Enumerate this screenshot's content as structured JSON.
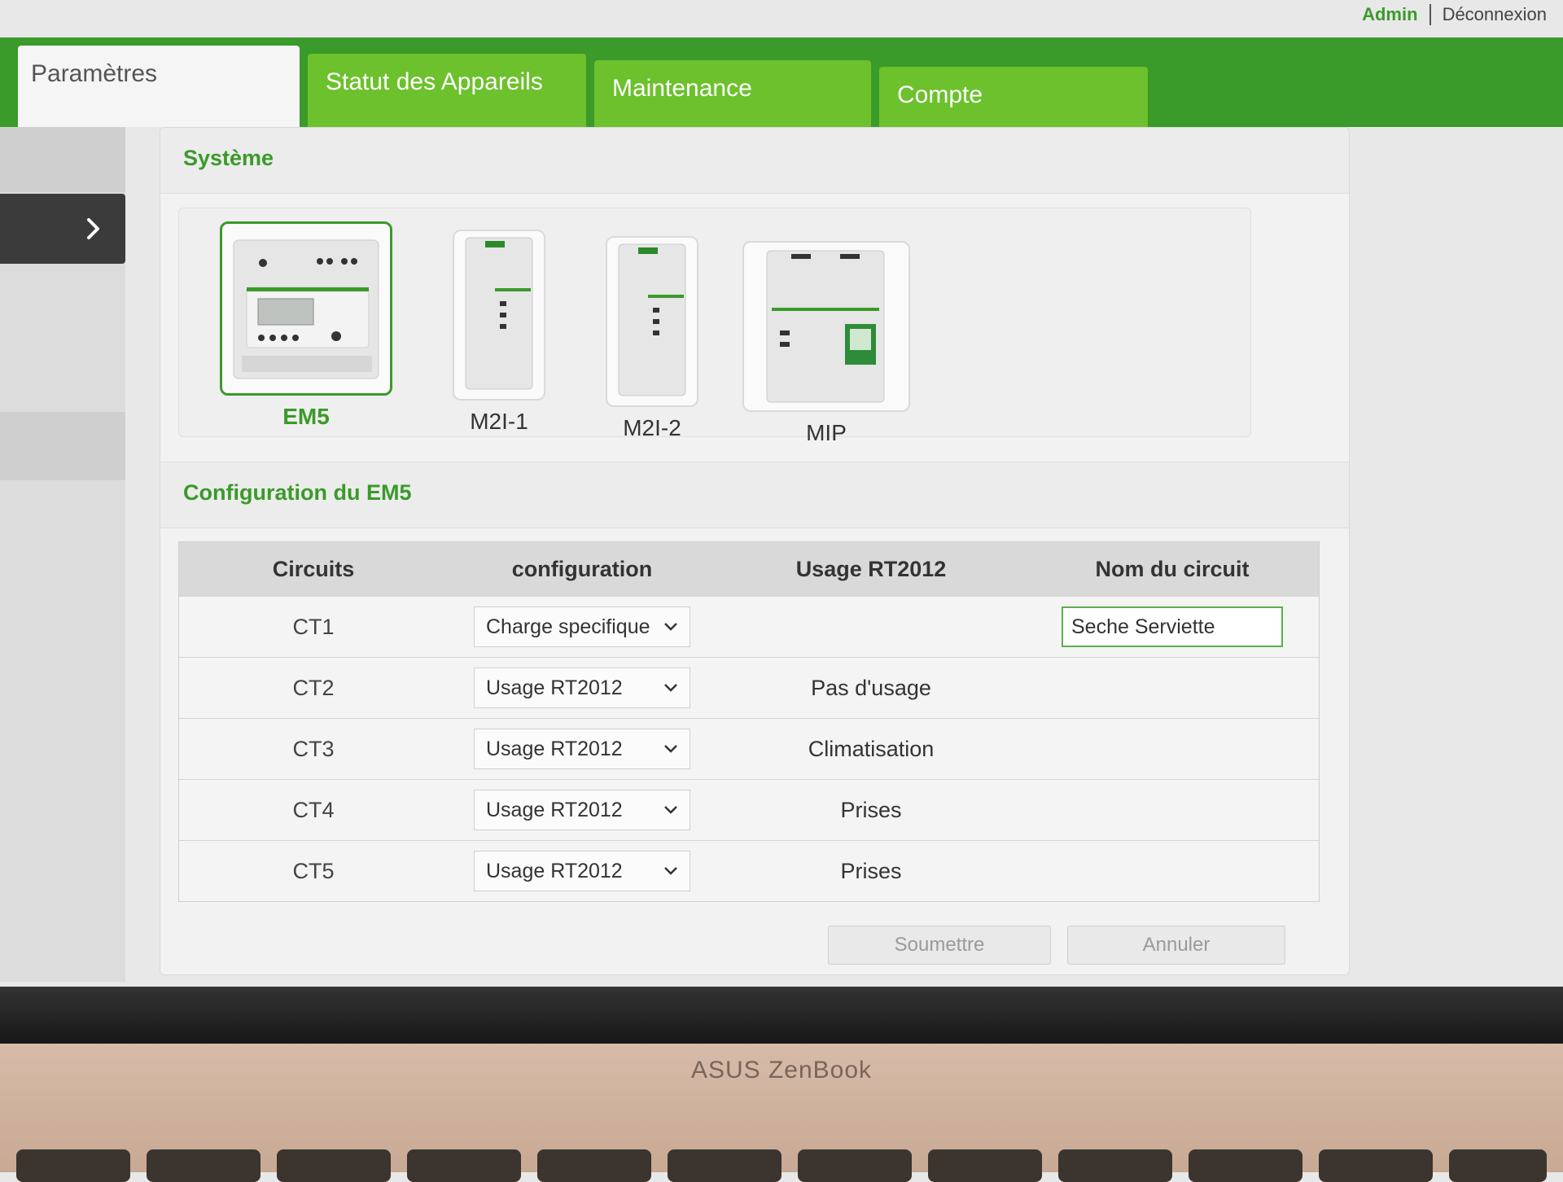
{
  "user": {
    "name": "Admin",
    "logout_label": "Déconnexion"
  },
  "nav": {
    "tabs": [
      {
        "label": "Paramètres",
        "active": true
      },
      {
        "label": "Statut des Appareils",
        "active": false
      },
      {
        "label": "Maintenance",
        "active": false
      },
      {
        "label": "Compte",
        "active": false
      }
    ]
  },
  "sidebar": {
    "toggle_icon": "chevron-right-icon"
  },
  "system": {
    "title": "Système",
    "devices": [
      {
        "label": "EM5",
        "selected": true
      },
      {
        "label": "M2I-1",
        "selected": false
      },
      {
        "label": "M2I-2",
        "selected": false
      },
      {
        "label": "MIP",
        "selected": false
      }
    ]
  },
  "config": {
    "title": "Configuration du EM5",
    "headers": [
      "Circuits",
      "configuration",
      "Usage RT2012",
      "Nom du circuit"
    ],
    "rows": [
      {
        "circuit": "CT1",
        "configuration": "Charge specifique",
        "usage": "",
        "name": "Seche Serviette"
      },
      {
        "circuit": "CT2",
        "configuration": "Usage RT2012",
        "usage": "Pas d'usage",
        "name": ""
      },
      {
        "circuit": "CT3",
        "configuration": "Usage RT2012",
        "usage": "Climatisation",
        "name": ""
      },
      {
        "circuit": "CT4",
        "configuration": "Usage RT2012",
        "usage": "Prises",
        "name": ""
      },
      {
        "circuit": "CT5",
        "configuration": "Usage RT2012",
        "usage": "Prises",
        "name": ""
      }
    ],
    "submit_label": "Soumettre",
    "cancel_label": "Annuler"
  },
  "laptop": {
    "brand": "ASUS ZenBook"
  },
  "colors": {
    "brand_green": "#3a9a2a",
    "tab_green": "#6cc12c",
    "sidebar_dark": "#3b3b3b"
  }
}
